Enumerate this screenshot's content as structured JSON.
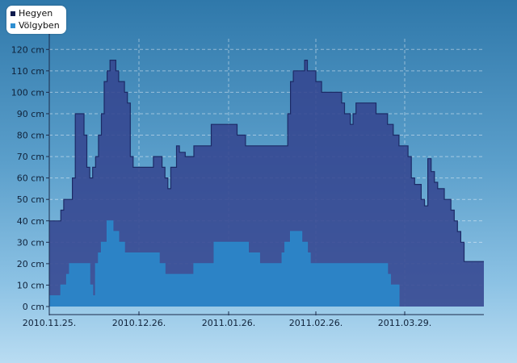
{
  "chart_data": {
    "type": "area",
    "title": "",
    "xlabel": "",
    "ylabel": "",
    "y_unit": "cm",
    "ylim": [
      0,
      125
    ],
    "yticks": [
      0,
      10,
      20,
      30,
      40,
      50,
      60,
      70,
      80,
      90,
      100,
      110,
      120
    ],
    "y_tick_labels": [
      "0 cm",
      "10 cm",
      "20 cm",
      "30 cm",
      "40 cm",
      "50 cm",
      "60 cm",
      "70 cm",
      "80 cm",
      "90 cm",
      "100 cm",
      "110 cm",
      "120 cm"
    ],
    "xlim": [
      "2010-11-25",
      "2011-04-22"
    ],
    "x_tick_dates": [
      "2010-11-25",
      "2010-12-26",
      "2011-01-26",
      "2011-02-26",
      "2011-03-29"
    ],
    "x_tick_labels": [
      "2010.11.25.",
      "2010.12.26.",
      "2011.01.26.",
      "2011.02.26.",
      "2011.03.29."
    ],
    "grid": true,
    "legend_position": "top-left",
    "step": true,
    "series": [
      {
        "name": "Hegyen",
        "fill_color": "#34468f",
        "line_color": "#1c2a66",
        "legend_color": "#0e1b4d",
        "points": [
          [
            "2010-11-25",
            40
          ],
          [
            "2010-11-29",
            45
          ],
          [
            "2010-11-30",
            50
          ],
          [
            "2010-12-03",
            60
          ],
          [
            "2010-12-04",
            90
          ],
          [
            "2010-12-07",
            80
          ],
          [
            "2010-12-08",
            65
          ],
          [
            "2010-12-09",
            60
          ],
          [
            "2010-12-10",
            65
          ],
          [
            "2010-12-11",
            70
          ],
          [
            "2010-12-12",
            80
          ],
          [
            "2010-12-13",
            90
          ],
          [
            "2010-12-14",
            105
          ],
          [
            "2010-12-15",
            110
          ],
          [
            "2010-12-16",
            115
          ],
          [
            "2010-12-18",
            110
          ],
          [
            "2010-12-19",
            105
          ],
          [
            "2010-12-21",
            100
          ],
          [
            "2010-12-22",
            95
          ],
          [
            "2010-12-23",
            70
          ],
          [
            "2010-12-24",
            65
          ],
          [
            "2010-12-30",
            65
          ],
          [
            "2010-12-31",
            70
          ],
          [
            "2011-01-03",
            65
          ],
          [
            "2011-01-04",
            60
          ],
          [
            "2011-01-05",
            55
          ],
          [
            "2011-01-06",
            65
          ],
          [
            "2011-01-08",
            75
          ],
          [
            "2011-01-09",
            72
          ],
          [
            "2011-01-11",
            70
          ],
          [
            "2011-01-14",
            75
          ],
          [
            "2011-01-20",
            85
          ],
          [
            "2011-01-29",
            80
          ],
          [
            "2011-02-01",
            75
          ],
          [
            "2011-02-16",
            90
          ],
          [
            "2011-02-17",
            105
          ],
          [
            "2011-02-18",
            110
          ],
          [
            "2011-02-22",
            115
          ],
          [
            "2011-02-23",
            110
          ],
          [
            "2011-02-26",
            105
          ],
          [
            "2011-02-28",
            100
          ],
          [
            "2011-03-07",
            95
          ],
          [
            "2011-03-08",
            90
          ],
          [
            "2011-03-10",
            85
          ],
          [
            "2011-03-11",
            90
          ],
          [
            "2011-03-12",
            95
          ],
          [
            "2011-03-19",
            90
          ],
          [
            "2011-03-23",
            85
          ],
          [
            "2011-03-25",
            80
          ],
          [
            "2011-03-27",
            75
          ],
          [
            "2011-03-30",
            70
          ],
          [
            "2011-03-31",
            60
          ],
          [
            "2011-04-01",
            57
          ],
          [
            "2011-04-03",
            50
          ],
          [
            "2011-04-04",
            47
          ],
          [
            "2011-04-05",
            69
          ],
          [
            "2011-04-06",
            63
          ],
          [
            "2011-04-07",
            58
          ],
          [
            "2011-04-08",
            55
          ],
          [
            "2011-04-10",
            50
          ],
          [
            "2011-04-12",
            45
          ],
          [
            "2011-04-13",
            40
          ],
          [
            "2011-04-14",
            35
          ],
          [
            "2011-04-15",
            30
          ],
          [
            "2011-04-16",
            21
          ],
          [
            "2011-04-22",
            21
          ]
        ]
      },
      {
        "name": "Völgyben",
        "fill_color": "#2b86c8",
        "line_color": "#2b86c8",
        "legend_color": "#2e8fd2",
        "points": [
          [
            "2010-11-25",
            5
          ],
          [
            "2010-11-29",
            10
          ],
          [
            "2010-12-01",
            15
          ],
          [
            "2010-12-02",
            20
          ],
          [
            "2010-12-09",
            10
          ],
          [
            "2010-12-10",
            5
          ],
          [
            "2010-12-11",
            20
          ],
          [
            "2010-12-12",
            25
          ],
          [
            "2010-12-13",
            30
          ],
          [
            "2010-12-15",
            40
          ],
          [
            "2010-12-17",
            35
          ],
          [
            "2010-12-19",
            30
          ],
          [
            "2010-12-21",
            25
          ],
          [
            "2011-01-02",
            20
          ],
          [
            "2011-01-04",
            15
          ],
          [
            "2011-01-14",
            20
          ],
          [
            "2011-01-21",
            30
          ],
          [
            "2011-02-02",
            25
          ],
          [
            "2011-02-06",
            20
          ],
          [
            "2011-02-14",
            25
          ],
          [
            "2011-02-15",
            30
          ],
          [
            "2011-02-17",
            35
          ],
          [
            "2011-02-21",
            30
          ],
          [
            "2011-02-23",
            25
          ],
          [
            "2011-02-24",
            20
          ],
          [
            "2011-03-23",
            15
          ],
          [
            "2011-03-24",
            10
          ],
          [
            "2011-03-27",
            0
          ]
        ]
      }
    ]
  }
}
